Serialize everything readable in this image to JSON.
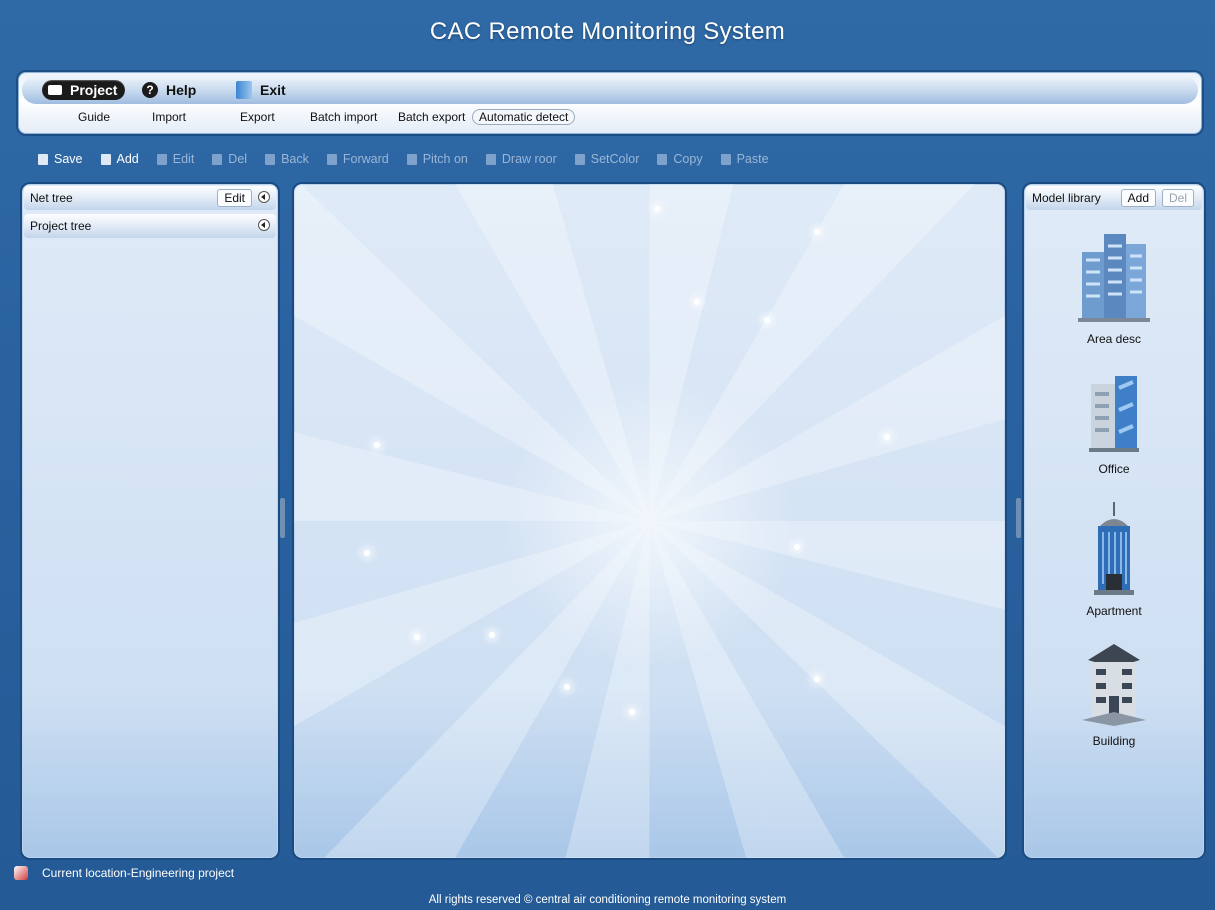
{
  "title": "CAC Remote Monitoring System",
  "menu": {
    "items": [
      {
        "label": "Project",
        "icon": "project-icon"
      },
      {
        "label": "Help",
        "icon": "help-icon"
      },
      {
        "label": "Exit",
        "icon": "exit-icon"
      }
    ],
    "submenu": [
      "Guide",
      "Import",
      "Export",
      "Batch import",
      "Batch export",
      "Automatic detect"
    ]
  },
  "toolbar": [
    {
      "label": "Save",
      "icon": "save-icon",
      "enabled": true
    },
    {
      "label": "Add",
      "icon": "add-icon",
      "enabled": true
    },
    {
      "label": "Edit",
      "icon": "edit-icon",
      "enabled": false
    },
    {
      "label": "Del",
      "icon": "delete-icon",
      "enabled": false
    },
    {
      "label": "Back",
      "icon": "back-icon",
      "enabled": false
    },
    {
      "label": "Forward",
      "icon": "forward-icon",
      "enabled": false
    },
    {
      "label": "Pitch on",
      "icon": "pointer-icon",
      "enabled": false
    },
    {
      "label": "Draw roor",
      "icon": "draw-icon",
      "enabled": false
    },
    {
      "label": "SetColor",
      "icon": "color-icon",
      "enabled": false
    },
    {
      "label": "Copy",
      "icon": "copy-icon",
      "enabled": false
    },
    {
      "label": "Paste",
      "icon": "paste-icon",
      "enabled": false
    }
  ],
  "left_panel": {
    "net_tree": "Net tree",
    "edit_button": "Edit",
    "project_tree": "Project tree"
  },
  "right_panel": {
    "title": "Model library",
    "add_button": "Add",
    "del_button": "Del",
    "models": [
      {
        "label": "Area desc",
        "icon": "towers-icon"
      },
      {
        "label": "Office",
        "icon": "office-building-icon"
      },
      {
        "label": "Apartment",
        "icon": "apartment-icon"
      },
      {
        "label": "Building",
        "icon": "building-icon"
      }
    ]
  },
  "status": {
    "location": "Current location-Engineering project"
  },
  "footer": "All rights reserved © central air conditioning remote monitoring system",
  "colors": {
    "background": "#2a62a0",
    "panel": "#dfeaf7",
    "accent": "#1b4b80"
  }
}
